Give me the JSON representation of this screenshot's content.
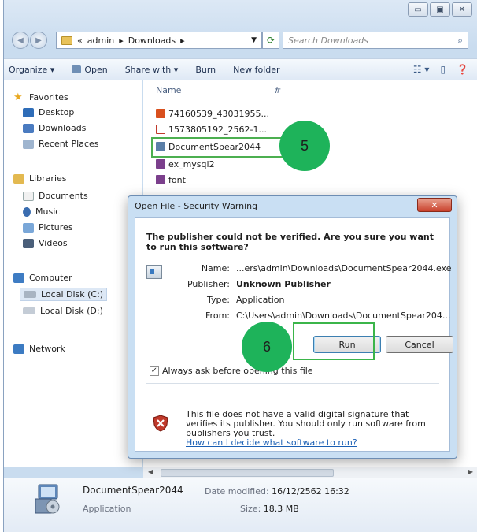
{
  "address": {
    "root": "«",
    "segments": [
      "admin",
      "Downloads"
    ],
    "separator": "▸"
  },
  "search": {
    "placeholder": "Search Downloads"
  },
  "toolbar": {
    "organize": "Organize ▾",
    "open": "Open",
    "share_with": "Share with ▾",
    "burn": "Burn",
    "new_folder": "New folder"
  },
  "nav": {
    "favorites": "Favorites",
    "desktop": "Desktop",
    "downloads": "Downloads",
    "recent_places": "Recent Places",
    "libraries": "Libraries",
    "documents": "Documents",
    "music": "Music",
    "pictures": "Pictures",
    "videos": "Videos",
    "computer": "Computer",
    "local_c": "Local Disk (C:)",
    "local_d": "Local Disk (D:)",
    "network": "Network"
  },
  "files": {
    "col_name": "Name",
    "col_hash": "#",
    "items": [
      "74160539_43031955...",
      "1573805192_2562-1...",
      "DocumentSpear2044",
      "ex_mysql2",
      "font"
    ]
  },
  "dialog": {
    "title": "Open File - Security Warning",
    "close": "✕",
    "heading": "The publisher could not be verified.  Are you sure you want to run this software?",
    "name_label": "Name:",
    "name_value": "...ers\\admin\\Downloads\\DocumentSpear2044.exe",
    "publisher_label": "Publisher:",
    "publisher_value": "Unknown Publisher",
    "type_label": "Type:",
    "type_value": "Application",
    "from_label": "From:",
    "from_value": "C:\\Users\\admin\\Downloads\\DocumentSpear204...",
    "run": "Run",
    "cancel": "Cancel",
    "checkbox_label": "Always ask before opening this file",
    "checkbox_checked": true,
    "warning": "This file does not have a valid digital signature that verifies its publisher.  You should only run software from publishers you trust.",
    "link": "How can I decide what software to run?"
  },
  "details": {
    "name": "DocumentSpear2044",
    "type": "Application",
    "modified_label": "Date modified:",
    "modified_value": "16/12/2562 16:32",
    "size_label": "Size:",
    "size_value": "18.3 MB"
  },
  "steps": {
    "step5": "5",
    "step6": "6"
  },
  "colors": {
    "step_green": "#1eb35a",
    "highlight_green": "#3bb54a",
    "link_blue": "#1a5fb4"
  }
}
